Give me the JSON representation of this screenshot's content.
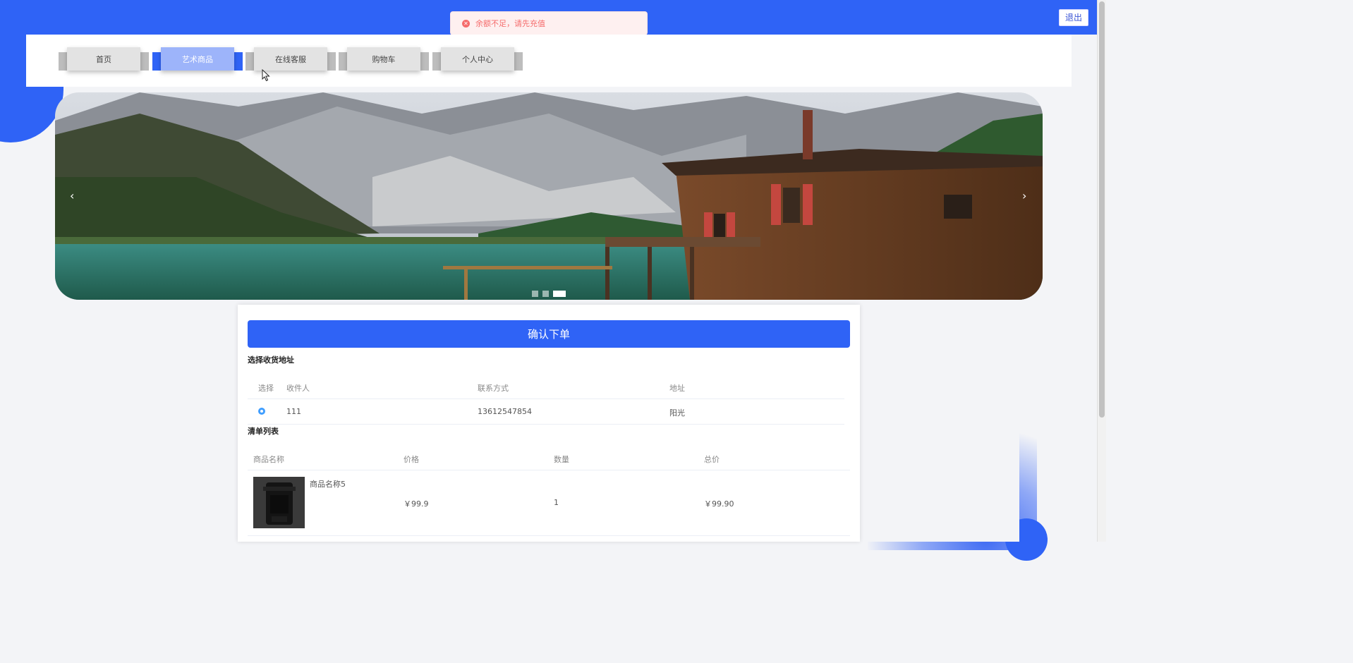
{
  "header": {
    "logout_label": "退出"
  },
  "toast": {
    "message": "余额不足，请先充值",
    "icon": "error-circle-icon"
  },
  "nav": {
    "items": [
      {
        "label": "首页",
        "active": false
      },
      {
        "label": "艺术商品",
        "active": true
      },
      {
        "label": "在线客服",
        "active": false
      },
      {
        "label": "购物车",
        "active": false
      },
      {
        "label": "个人中心",
        "active": false
      }
    ]
  },
  "carousel": {
    "prev_glyph": "‹",
    "next_glyph": "›",
    "slide_count": 3,
    "active_index": 2
  },
  "order": {
    "confirm_label": "确认下单",
    "address_section_title": "选择收货地址",
    "address_headers": {
      "select": "选择",
      "recipient": "收件人",
      "contact": "联系方式",
      "address": "地址"
    },
    "address_row": {
      "recipient": "111",
      "contact": "13612547854",
      "address": "阳光",
      "selected": true
    },
    "items_section_title": "清单列表",
    "items_headers": {
      "name": "商品名称",
      "price": "价格",
      "quantity": "数量",
      "total": "总价"
    },
    "item_row": {
      "name": "商品名称5",
      "price": "￥99.9",
      "quantity": "1",
      "total": "￥99.90"
    }
  },
  "colors": {
    "primary": "#2f63f6",
    "error": "#f56c6c",
    "radio": "#409eff"
  }
}
